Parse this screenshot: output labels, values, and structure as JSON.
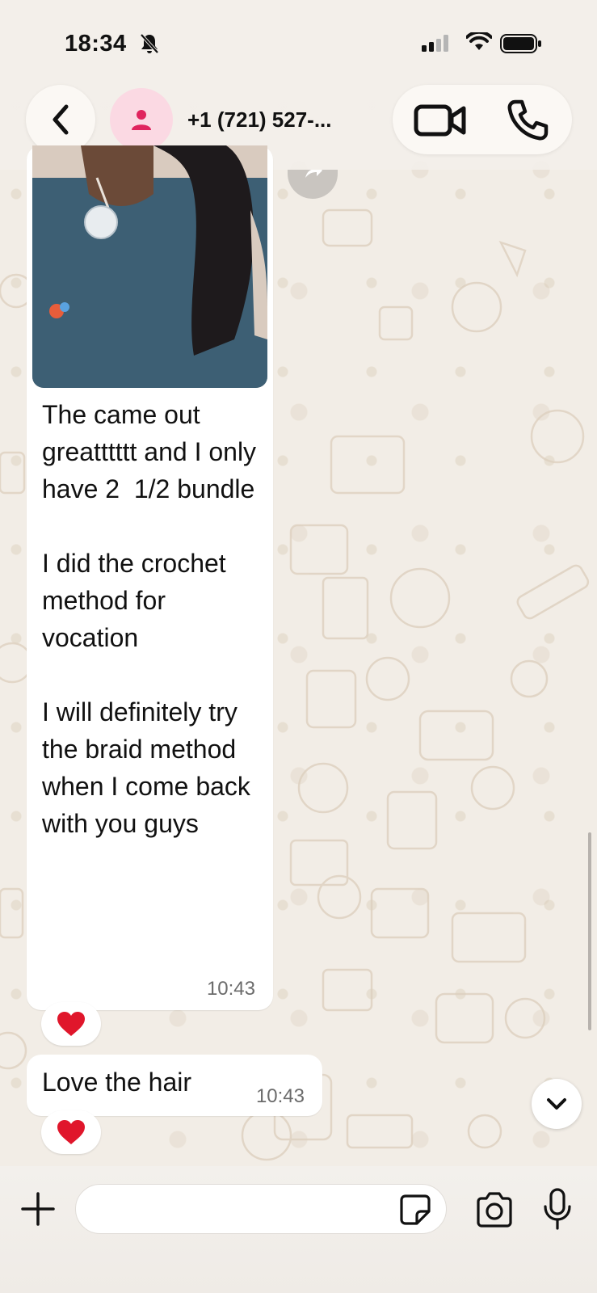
{
  "status_bar": {
    "time": "18:34",
    "icons": [
      "bell-slash-icon",
      "signal-icon",
      "wifi-icon",
      "battery-icon"
    ]
  },
  "header": {
    "back_icon": "chevron-left-icon",
    "avatar_icon": "person-icon",
    "contact_name": "+1 (721) 527-...",
    "video_icon": "video-camera-icon",
    "phone_icon": "phone-icon"
  },
  "messages": [
    {
      "type": "image-with-caption",
      "text": "The came out greatttttt and I only have 2  1/2 bundle\n\nI did the crochet method for vocation\n\nI will definitely try the braid method when I come back with you guys",
      "time": "10:43",
      "reaction": "❤️"
    },
    {
      "type": "text",
      "text": "Love the hair",
      "time": "10:43",
      "reaction": "❤️"
    }
  ],
  "input_bar": {
    "plus_icon": "plus-icon",
    "placeholder": "",
    "sticker_icon": "sticker-icon",
    "camera_icon": "camera-icon",
    "mic_icon": "microphone-icon"
  },
  "colors": {
    "background": "#efeae2",
    "bubble": "#ffffff",
    "avatar_bg": "#fbd9e3",
    "avatar_fg": "#e0245e",
    "heart": "#e0162b"
  }
}
